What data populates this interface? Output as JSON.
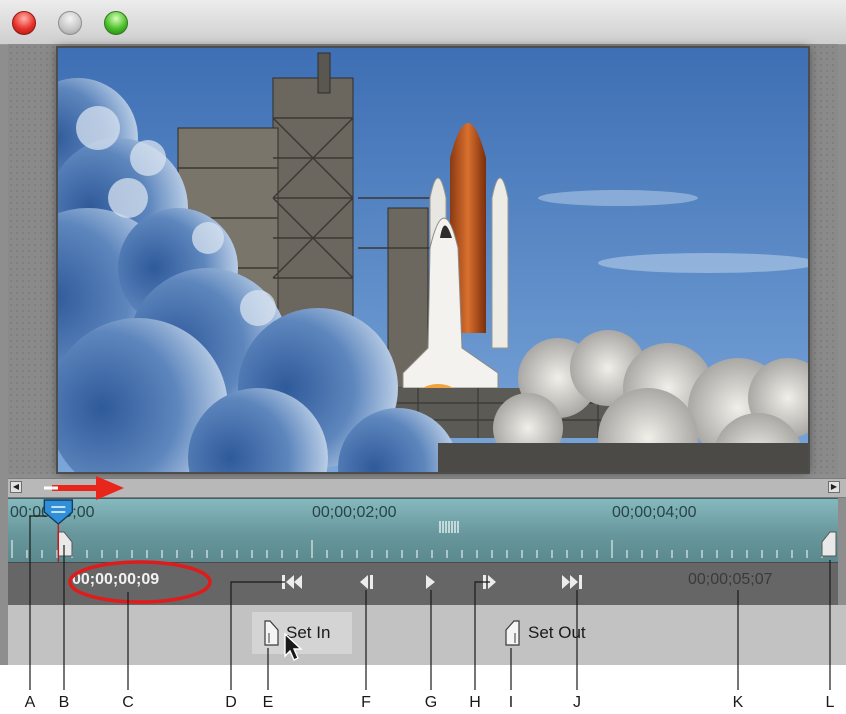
{
  "timeline": {
    "tick_labels": [
      "00;00;00;00",
      "00;00;02;00",
      "00;00;04;00"
    ],
    "playhead_fraction": 0.015
  },
  "transport": {
    "current_timecode": "00;00;00;09",
    "duration_timecode": "00;00;05;07"
  },
  "buttons": {
    "set_in": "Set In",
    "set_out": "Set Out"
  },
  "callouts": [
    "A",
    "B",
    "C",
    "D",
    "E",
    "F",
    "G",
    "H",
    "I",
    "J",
    "K",
    "L"
  ],
  "colors": {
    "timeline": "#67979c",
    "playhead": "#2f8fd8",
    "highlight_ellipse": "#e01b1b",
    "arrow": "#e8261c"
  },
  "icons": {
    "go_to_in": "skip-to-start-icon",
    "step_back": "step-back-icon",
    "play": "play-icon",
    "step_forward": "step-forward-icon",
    "go_to_out": "skip-to-end-icon",
    "in_point": "in-point-marker-icon",
    "out_point": "out-point-marker-icon",
    "cursor": "mouse-cursor-icon",
    "playhead": "current-time-indicator-icon",
    "direction_arrow": "red-right-arrow-icon"
  }
}
